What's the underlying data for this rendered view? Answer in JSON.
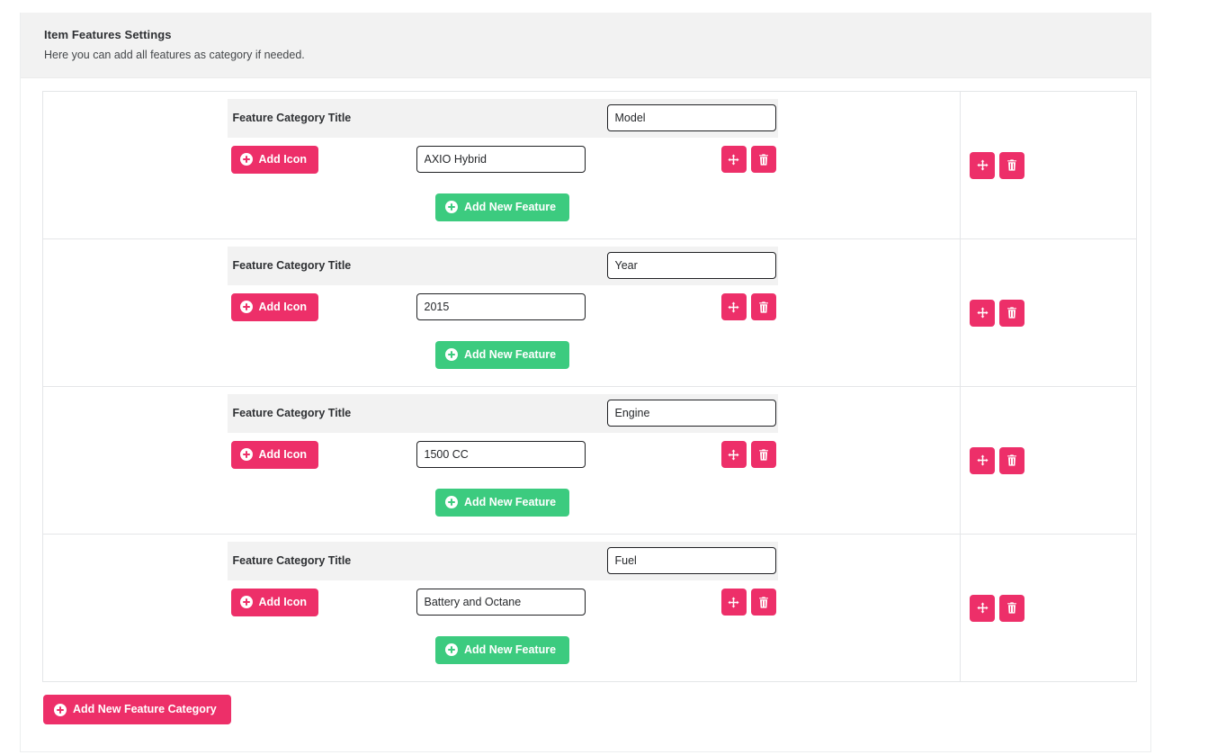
{
  "header": {
    "title": "Item Features Settings",
    "subtitle": "Here you can add all features as category if needed."
  },
  "labels": {
    "category_title_label": "Feature Category Title",
    "add_icon_label": "Add Icon",
    "add_new_feature_label": "Add New Feature",
    "add_new_feature_category_label": "Add New Feature Category"
  },
  "icons": {
    "plus": "plus-circle-icon",
    "move": "move-arrows-icon",
    "delete": "trash-icon"
  },
  "colors": {
    "pink": "#ed2f69",
    "green": "#3ccb7f",
    "header_bg": "#f2f2f2",
    "row_title_bg": "#f2f2f2",
    "border": "#e4e6e8"
  },
  "categories": [
    {
      "title_label": "Feature Category Title",
      "title_value": "Model",
      "features": [
        {
          "add_icon_label": "Add Icon",
          "value": "AXIO Hybrid"
        }
      ],
      "add_feature_label": "Add New Feature"
    },
    {
      "title_label": "Feature Category Title",
      "title_value": "Year",
      "features": [
        {
          "add_icon_label": "Add Icon",
          "value": "2015"
        }
      ],
      "add_feature_label": "Add New Feature"
    },
    {
      "title_label": "Feature Category Title",
      "title_value": "Engine",
      "features": [
        {
          "add_icon_label": "Add Icon",
          "value": "1500 CC"
        }
      ],
      "add_feature_label": "Add New Feature"
    },
    {
      "title_label": "Feature Category Title",
      "title_value": "Fuel",
      "features": [
        {
          "add_icon_label": "Add Icon",
          "value": "Battery and Octane"
        }
      ],
      "add_feature_label": "Add New Feature"
    }
  ]
}
